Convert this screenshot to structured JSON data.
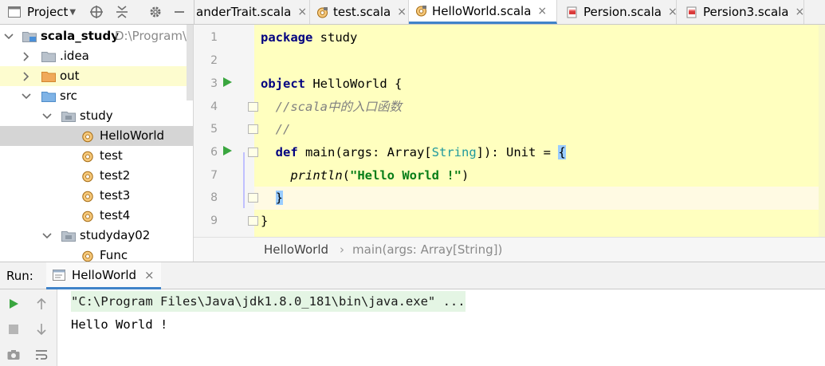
{
  "project_panel": {
    "title": "Project",
    "title_icon": "project-window-icon",
    "header_icons": [
      "locate-target-icon",
      "collapse-all-icon",
      "gear-icon",
      "hide-minus-icon"
    ]
  },
  "tabs": [
    {
      "label": "anderTrait.scala",
      "icon": "none",
      "active": false
    },
    {
      "label": "test.scala",
      "icon": "scala-object-icon",
      "active": false
    },
    {
      "label": "HelloWorld.scala",
      "icon": "scala-object-icon",
      "active": true
    },
    {
      "label": "Persion.scala",
      "icon": "scala-class-icon",
      "active": false
    },
    {
      "label": "Persion3.scala",
      "icon": "scala-class-icon",
      "active": false
    }
  ],
  "tab_close_glyph": "×",
  "tree": [
    {
      "label": "scala_study",
      "extra": "D:\\Program\\Id",
      "level": 0,
      "expanded": true,
      "icon": "project-folder-icon",
      "bold": true
    },
    {
      "label": ".idea",
      "level": 1,
      "expanded": false,
      "icon": "gray-folder-icon"
    },
    {
      "label": "out",
      "level": 1,
      "expanded": false,
      "icon": "orange-folder-icon"
    },
    {
      "label": "src",
      "level": 1,
      "expanded": true,
      "icon": "blue-folder-icon"
    },
    {
      "label": "study",
      "level": 2,
      "expanded": true,
      "icon": "package-icon"
    },
    {
      "label": "HelloWorld",
      "level": 3,
      "icon": "scala-object-icon",
      "selected": true
    },
    {
      "label": "test",
      "level": 3,
      "icon": "scala-object-icon"
    },
    {
      "label": "test2",
      "level": 3,
      "icon": "scala-object-icon"
    },
    {
      "label": "test3",
      "level": 3,
      "icon": "scala-object-icon"
    },
    {
      "label": "test4",
      "level": 3,
      "icon": "scala-object-icon"
    },
    {
      "label": "studyday02",
      "level": 2,
      "expanded": true,
      "icon": "package-icon"
    },
    {
      "label": "Func",
      "level": 3,
      "icon": "scala-object-icon"
    }
  ],
  "editor": {
    "line_numbers": [
      "1",
      "2",
      "3",
      "4",
      "5",
      "6",
      "7",
      "8",
      "9"
    ],
    "lines": [
      [
        {
          "t": "package",
          "c": "kw"
        },
        {
          "t": " study",
          "c": ""
        }
      ],
      [],
      [
        {
          "t": "object",
          "c": "kw"
        },
        {
          "t": " HelloWorld {",
          "c": ""
        }
      ],
      [
        {
          "t": "  //scala中的入口函数",
          "c": "cm"
        }
      ],
      [
        {
          "t": "  //",
          "c": "cm"
        }
      ],
      [
        {
          "t": "  ",
          "c": ""
        },
        {
          "t": "def",
          "c": "kw"
        },
        {
          "t": " main(args: Array[",
          "c": ""
        },
        {
          "t": "String",
          "c": "ty"
        },
        {
          "t": "]): Unit = ",
          "c": ""
        },
        {
          "t": "{",
          "c": "brace"
        }
      ],
      [
        {
          "t": "    ",
          "c": ""
        },
        {
          "t": "println",
          "c": "fn"
        },
        {
          "t": "(",
          "c": ""
        },
        {
          "t": "\"Hello World !\"",
          "c": "str"
        },
        {
          "t": ")",
          "c": ""
        }
      ],
      [
        {
          "t": "  ",
          "c": ""
        },
        {
          "t": "}",
          "c": "brace"
        }
      ],
      [
        {
          "t": "}",
          "c": ""
        }
      ]
    ],
    "run_gutter_lines": [
      3,
      6
    ],
    "fold_lines": [
      4,
      5,
      6,
      8,
      9
    ]
  },
  "breadcrumb": {
    "items": [
      "HelloWorld",
      "main(args: Array[String])"
    ],
    "separator": "›"
  },
  "run_panel": {
    "label": "Run:",
    "tab_label": "HelloWorld",
    "tab_icon": "console-icon",
    "tab_close": "×",
    "tools": [
      "rerun-play-icon",
      "up-arrow-icon",
      "stop-icon",
      "down-arrow-icon",
      "camera-icon",
      "soft-wrap-icon"
    ],
    "console_lines": [
      "\"C:\\Program Files\\Java\\jdk1.8.0_181\\bin\\java.exe\" ...",
      "Hello World !"
    ]
  },
  "colors": {
    "editor_bg": "#ffffbf",
    "keyword": "#000080",
    "string": "#067d17",
    "type": "#20999d",
    "accent": "#4083c9",
    "run_green": "#3aa63f"
  }
}
